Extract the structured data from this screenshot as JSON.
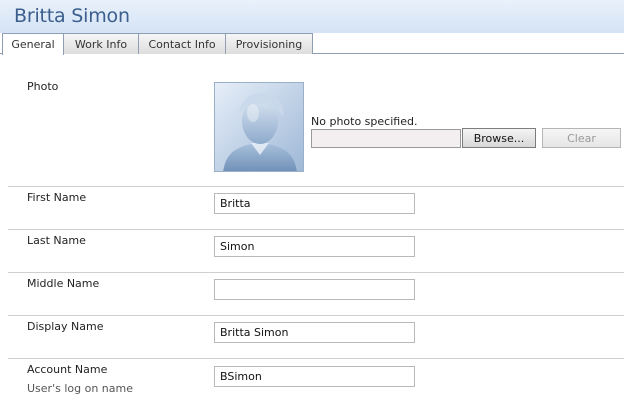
{
  "header": {
    "title": "Britta Simon"
  },
  "tabs": [
    {
      "label": "General",
      "active": true
    },
    {
      "label": "Work Info",
      "active": false
    },
    {
      "label": "Contact Info",
      "active": false
    },
    {
      "label": "Provisioning",
      "active": false
    }
  ],
  "photo": {
    "label": "Photo",
    "status": "No photo specified.",
    "browse_label": "Browse...",
    "clear_label": "Clear",
    "path_value": ""
  },
  "fields": {
    "first_name": {
      "label": "First Name",
      "value": "Britta"
    },
    "last_name": {
      "label": "Last Name",
      "value": "Simon"
    },
    "middle_name": {
      "label": "Middle Name",
      "value": ""
    },
    "display_name": {
      "label": "Display Name",
      "value": "Britta Simon"
    },
    "account_name": {
      "label": "Account Name",
      "sublabel": "User's log on name",
      "value": "BSimon"
    }
  },
  "colors": {
    "title": "#3b5e8c",
    "header_bg": "#dce8f7",
    "tab_border": "#8f9eb3"
  }
}
